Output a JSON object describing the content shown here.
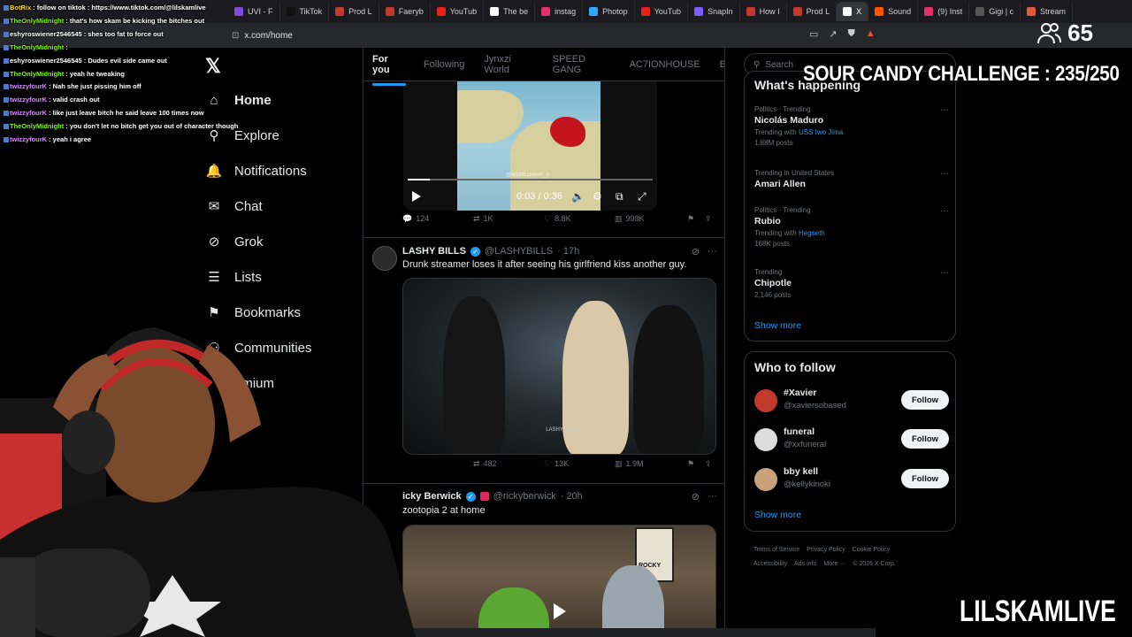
{
  "browser": {
    "tabs": [
      "UVI - F",
      "TikTok",
      "Prod L",
      "Faeryb",
      "YouTub",
      "The be",
      "instag",
      "Photop",
      "YouTub",
      "SnapIn",
      "How I",
      "Prod L",
      "X",
      "Sound",
      "(9) Inst",
      "Gigi | c",
      "Stream"
    ],
    "url": "x.com/home"
  },
  "stream": {
    "viewer_count": "65",
    "challenge": "SOUR CANDY CHALLENGE : 235/250",
    "brand": "LILSKAMLIVE"
  },
  "chat": [
    {
      "user": "BotRix",
      "color": "#ffdd00",
      "text": ": follow on tiktok : https://www.tiktok.com/@lilskamlive"
    },
    {
      "user": "TheOnlyMidnight",
      "color": "#7cfc00",
      "text": ": that's how skam be kicking the bitches out"
    },
    {
      "user": "eshyroswiener2546545",
      "color": "#ffffff",
      "text": ": shes too fat to force out"
    },
    {
      "user": "TheOnlyMidnight",
      "color": "#7cfc00",
      "text": ": "
    },
    {
      "user": "eshyroswiener2546545",
      "color": "#ffffff",
      "text": ": Dudes evil side came out"
    },
    {
      "user": "TheOnlyMidnight",
      "color": "#7cfc00",
      "text": ": yeah he tweaking"
    },
    {
      "user": "twizzyfourK",
      "color": "#d78bff",
      "text": ": Nah she just pissing him off"
    },
    {
      "user": "twizzyfourK",
      "color": "#d78bff",
      "text": ": valid crash out"
    },
    {
      "user": "twizzyfourK",
      "color": "#d78bff",
      "text": ": like just leave bitch he said leave 100 times now"
    },
    {
      "user": "TheOnlyMidnight",
      "color": "#7cfc00",
      "text": ": you don't let no bitch get you out of character though"
    },
    {
      "user": "twizzyfourK",
      "color": "#d78bff",
      "text": ": yeah i agree"
    }
  ],
  "sidebar": {
    "items": [
      {
        "label": "Home",
        "icon": "home-icon",
        "glyph": "⌂"
      },
      {
        "label": "Explore",
        "icon": "search-icon",
        "glyph": "⚲"
      },
      {
        "label": "Notifications",
        "icon": "bell-icon",
        "glyph": "🔔"
      },
      {
        "label": "Chat",
        "icon": "mail-icon",
        "glyph": "✉"
      },
      {
        "label": "Grok",
        "icon": "grok-icon",
        "glyph": "⊘"
      },
      {
        "label": "Lists",
        "icon": "list-icon",
        "glyph": "☰"
      },
      {
        "label": "Bookmarks",
        "icon": "bookmark-icon",
        "glyph": "⚑"
      },
      {
        "label": "Communities",
        "icon": "communities-icon",
        "glyph": "⚇"
      },
      {
        "label": "emium",
        "icon": "premium-icon",
        "glyph": ""
      }
    ]
  },
  "feed": {
    "tabs": [
      "For you",
      "Following",
      "Jynxzi World",
      "SPEED GANG",
      "AC7IONHOUSE",
      "B"
    ],
    "post1": {
      "video_time": "0:03 / 0:36",
      "watermark": "@WORLDWAR_3",
      "replies": "124",
      "reposts": "1K",
      "likes": "8.8K",
      "views": "998K"
    },
    "post2": {
      "name": "LASHY BILLS",
      "handle": "@LASHYBILLS",
      "time": "· 17h",
      "text": "Drunk streamer loses it after seeing his girlfriend kiss another guy.",
      "watermark": "LASHY BILLS",
      "reposts": "482",
      "likes": "13K",
      "views": "1.9M"
    },
    "post3": {
      "name": "icky Berwick",
      "handle": "@rickyberwick",
      "time": "· 20h",
      "text": "zootopia 2 at home",
      "sign": "ROCKY"
    }
  },
  "right": {
    "search_placeholder": "Search",
    "happening_title": "What's happening",
    "trends": [
      {
        "ctx": "Politics · Trending",
        "topic": "Nicolás Maduro",
        "sub_prefix": "Trending with ",
        "sub_link": "USS Iwo Jima",
        "posts": "1.88M posts"
      },
      {
        "ctx": "Trending in United States",
        "topic": "Amari Allen",
        "sub_prefix": "",
        "sub_link": "",
        "posts": ""
      },
      {
        "ctx": "Politics · Trending",
        "topic": "Rubio",
        "sub_prefix": "Trending with ",
        "sub_link": "Hegseth",
        "posts": "168K posts"
      },
      {
        "ctx": "Trending",
        "topic": "Chipotle",
        "sub_prefix": "",
        "sub_link": "",
        "posts": "2,146 posts"
      }
    ],
    "show_more": "Show more",
    "who_title": "Who to follow",
    "who": [
      {
        "name": "#Xavier",
        "handle": "@xaviersobased",
        "button": "Follow",
        "color": "#c0392b"
      },
      {
        "name": "funeral",
        "handle": "@xxfuneral",
        "button": "Follow",
        "color": "#dddddd"
      },
      {
        "name": "bby kell",
        "handle": "@kellykinoki",
        "button": "Follow",
        "color": "#c8a27a"
      }
    ],
    "footer": [
      "Terms of Service",
      "Privacy Policy",
      "Cookie Policy",
      "Accessibility",
      "Ads info",
      "More ···",
      "© 2026 X Corp."
    ]
  }
}
